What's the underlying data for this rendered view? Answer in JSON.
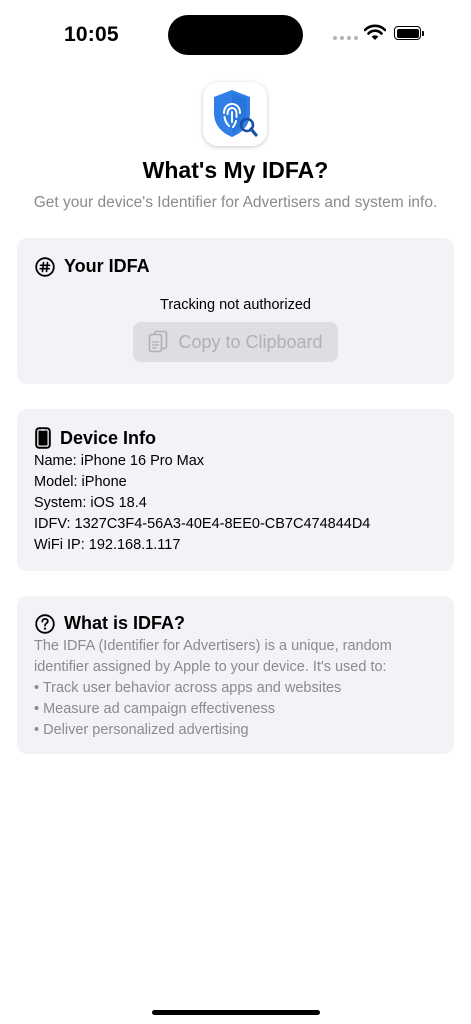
{
  "status_bar": {
    "time": "10:05"
  },
  "header": {
    "title": "What's My IDFA?",
    "subtitle": "Get your device's Identifier for Advertisers and system info."
  },
  "idfa_card": {
    "heading": "Your IDFA",
    "status": "Tracking not authorized",
    "copy_label": "Copy to Clipboard"
  },
  "device_card": {
    "heading": "Device Info",
    "lines": [
      "Name: iPhone 16 Pro Max",
      "Model: iPhone",
      "System: iOS 18.4",
      "IDFV: 1327C3F4-56A3-40E4-8EE0-CB7C474844D4",
      "WiFi IP: 192.168.1.117"
    ]
  },
  "about_card": {
    "heading": "What is IDFA?",
    "description_lines": [
      "The IDFA (Identifier for Advertisers) is a unique, random",
      "identifier assigned by Apple to your device. It's used to:"
    ],
    "bullets": [
      "• Track user behavior across apps and websites",
      "• Measure ad campaign effectiveness",
      "• Deliver personalized advertising"
    ]
  },
  "colors": {
    "background": "#ffffff",
    "card_background": "#f2f2f7",
    "secondary_text": "#8a8a8f",
    "disabled_button": "#dddde2",
    "icon_blue": "#2f7fe6"
  },
  "icons": {
    "app": "shield-fingerprint-icon",
    "idfa": "hash-circle-icon",
    "copy": "document-copy-icon",
    "device": "iphone-icon",
    "about": "question-circle-icon"
  }
}
